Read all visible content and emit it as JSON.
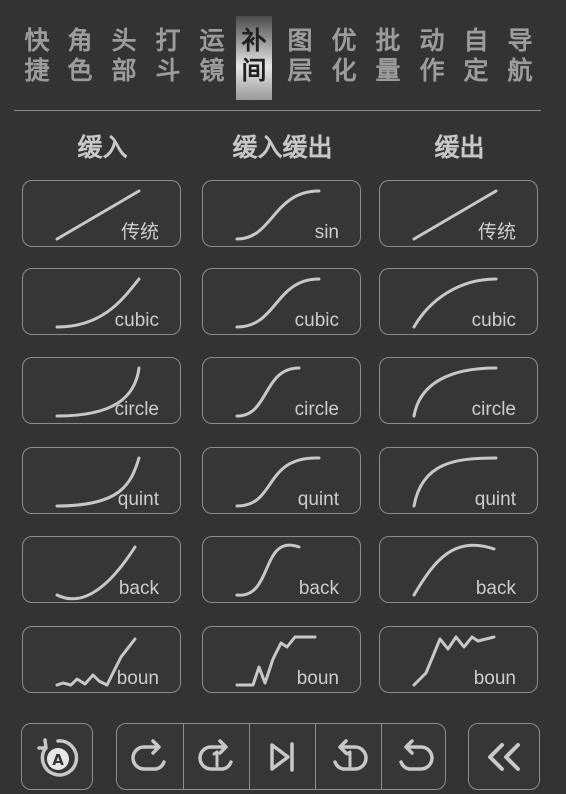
{
  "tabs": [
    {
      "top": "快",
      "bottom": "捷"
    },
    {
      "top": "角",
      "bottom": "色"
    },
    {
      "top": "头",
      "bottom": "部"
    },
    {
      "top": "打",
      "bottom": "斗"
    },
    {
      "top": "运",
      "bottom": "镜"
    },
    {
      "top": "补",
      "bottom": "间",
      "active": true
    },
    {
      "top": "图",
      "bottom": "层"
    },
    {
      "top": "优",
      "bottom": "化"
    },
    {
      "top": "批",
      "bottom": "量"
    },
    {
      "top": "动",
      "bottom": "作"
    },
    {
      "top": "自",
      "bottom": "定"
    },
    {
      "top": "导",
      "bottom": "航"
    }
  ],
  "columns": {
    "ease_in": "缓入",
    "ease_in_out": "缓入缓出",
    "ease_out": "缓出"
  },
  "rows": [
    {
      "key": "linear",
      "labels": [
        "传统",
        "sin",
        "传统"
      ]
    },
    {
      "key": "cubic",
      "labels": [
        "cubic",
        "cubic",
        "cubic"
      ]
    },
    {
      "key": "circle",
      "labels": [
        "circle",
        "circle",
        "circle"
      ]
    },
    {
      "key": "quint",
      "labels": [
        "quint",
        "quint",
        "quint"
      ]
    },
    {
      "key": "back",
      "labels": [
        "back",
        "back",
        "back"
      ]
    },
    {
      "key": "bounce",
      "labels": [
        "boun",
        "boun",
        "boun"
      ]
    }
  ],
  "toolbar": {
    "auto_icon": "auto-rotate-icon",
    "group_icons": [
      "loop-forward-icon",
      "loop-once-forward-icon",
      "skip-to-end-icon",
      "loop-once-backward-icon",
      "loop-backward-icon"
    ],
    "collapse_icon": "double-chevron-left-icon"
  },
  "colors": {
    "background": "#333333",
    "stroke": "#c8c8c8",
    "border": "#8d8d8d"
  }
}
